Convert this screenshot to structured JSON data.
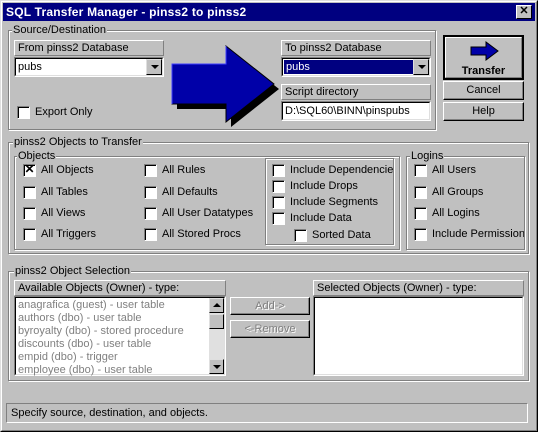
{
  "window": {
    "title": "SQL Transfer Manager - pinss2 to pinss2",
    "close_glyph": "✕"
  },
  "source_destination": {
    "group_label": "Source/Destination",
    "from_label": "From pinss2 Database",
    "from_value": "pubs",
    "to_label": "To pinss2 Database",
    "to_value": "pubs",
    "script_dir_label": "Script directory",
    "script_dir_value": "D:\\SQL60\\BINN\\pinspubs",
    "export_only_label": "Export Only",
    "export_only_checked": false,
    "arrow_color": "#0000a8"
  },
  "buttons": {
    "transfer": "Transfer",
    "cancel": "Cancel",
    "help": "Help"
  },
  "objects_to_transfer": {
    "group_label": "pinss2 Objects to Transfer",
    "objects_label": "Objects",
    "logins_label": "Logins",
    "checkboxes": {
      "all_objects": {
        "label": "All Objects",
        "checked": true
      },
      "all_tables": {
        "label": "All Tables",
        "checked": false
      },
      "all_views": {
        "label": "All Views",
        "checked": false
      },
      "all_triggers": {
        "label": "All Triggers",
        "checked": false
      },
      "all_rules": {
        "label": "All Rules",
        "checked": false
      },
      "all_defaults": {
        "label": "All Defaults",
        "checked": false
      },
      "all_user_datatypes": {
        "label": "All User Datatypes",
        "checked": false
      },
      "all_stored_procs": {
        "label": "All Stored Procs",
        "checked": false
      },
      "include_dependencies": {
        "label": "Include Dependencies",
        "checked": false
      },
      "include_drops": {
        "label": "Include Drops",
        "checked": false
      },
      "include_segments": {
        "label": "Include Segments",
        "checked": false
      },
      "include_data": {
        "label": "Include Data",
        "checked": false
      },
      "sorted_data": {
        "label": "Sorted Data",
        "checked": false
      },
      "all_users": {
        "label": "All Users",
        "checked": false
      },
      "all_groups": {
        "label": "All Groups",
        "checked": false
      },
      "all_logins": {
        "label": "All Logins",
        "checked": false
      },
      "include_permissions": {
        "label": "Include Permissions",
        "checked": false
      }
    }
  },
  "object_selection": {
    "group_label": "pinss2 Object Selection",
    "available_label": "Available Objects (Owner) - type:",
    "selected_label": "Selected Objects (Owner) - type:",
    "available_items": [
      "anagrafica (guest) - user table",
      "authors (dbo) - user table",
      "byroyalty (dbo) - stored procedure",
      "discounts (dbo) - user table",
      "empid (dbo) - trigger",
      "employee (dbo) - user table"
    ],
    "selected_items": [],
    "add_label": "Add->",
    "remove_label": "<-Remove"
  },
  "status_bar": {
    "text": "Specify source, destination, and objects."
  }
}
